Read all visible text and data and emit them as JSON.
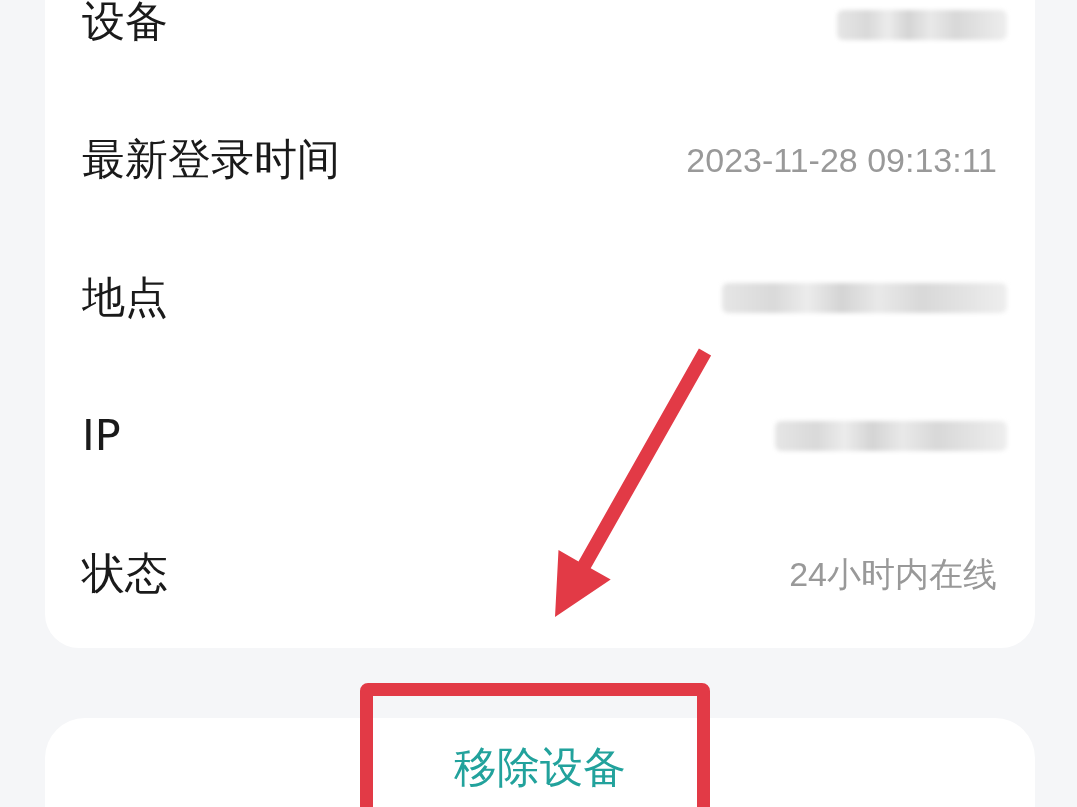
{
  "detail_card": {
    "rows": [
      {
        "label": "设备",
        "redacted": true
      },
      {
        "label": "最新登录时间",
        "redacted": false,
        "value": "2023-11-28 09:13:11"
      },
      {
        "label": "地点",
        "redacted": true
      },
      {
        "label": "IP",
        "redacted": true
      },
      {
        "label": "状态",
        "redacted": false,
        "value": "24小时内在线"
      }
    ]
  },
  "remove_button": {
    "label": "移除设备"
  },
  "annotations": {
    "pointer_arrow": true,
    "highlight_frame": true
  }
}
